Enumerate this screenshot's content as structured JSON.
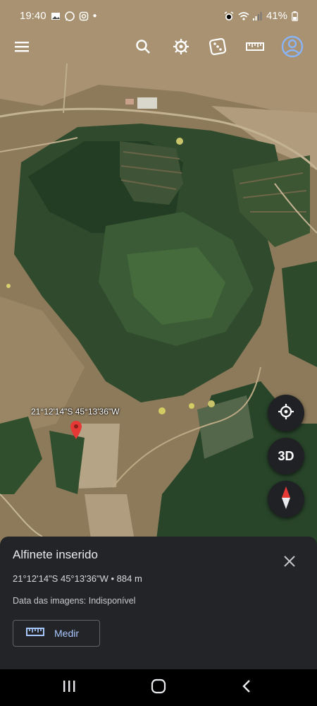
{
  "status": {
    "time": "19:40",
    "battery": "41%"
  },
  "toolbar": {
    "icons": [
      "menu-icon",
      "search-icon",
      "voyager-icon",
      "dice-icon",
      "ruler-icon",
      "account-icon"
    ]
  },
  "map": {
    "pin_label": "21°12'14\"S 45°13'36\"W",
    "view_3d_label": "3D"
  },
  "sheet": {
    "title": "Alfinete inserido",
    "coords": "21°12'14\"S 45°13'36\"W • 884 m",
    "imagery_label": "Data das imagens:",
    "imagery_value": "Indisponível",
    "measure_label": "Medir"
  },
  "colors": {
    "sheet_bg": "#232427",
    "accent": "#a9c7ff",
    "pin": "#e53935"
  }
}
